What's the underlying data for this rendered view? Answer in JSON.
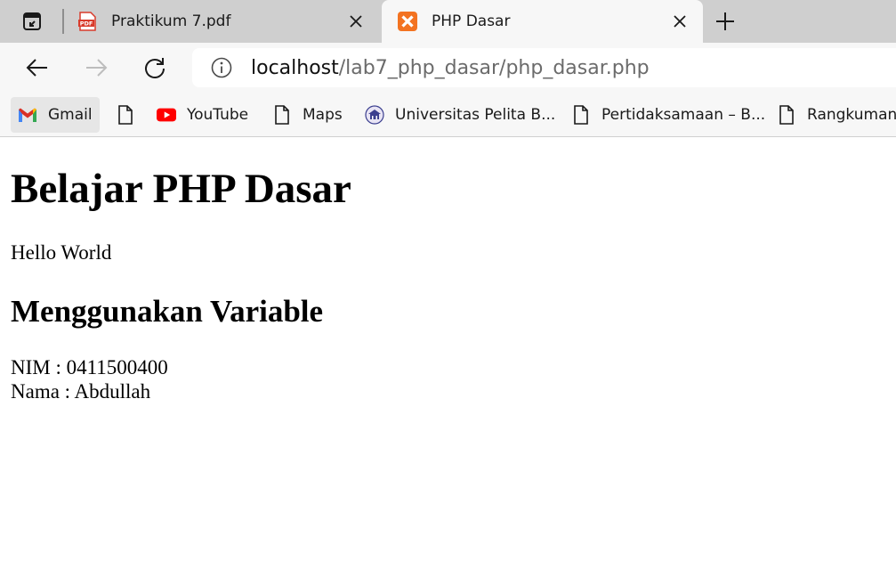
{
  "tabs": [
    {
      "title": "Praktikum 7.pdf",
      "icon": "pdf-icon",
      "active": false
    },
    {
      "title": "PHP Dasar",
      "icon": "xampp-icon",
      "active": true
    }
  ],
  "address": {
    "host": "localhost",
    "path": "/lab7_php_dasar/php_dasar.php"
  },
  "bookmarks": [
    {
      "label": "Gmail",
      "icon": "gmail-icon"
    },
    {
      "label": "",
      "icon": "page-icon"
    },
    {
      "label": "YouTube",
      "icon": "youtube-icon"
    },
    {
      "label": "Maps",
      "icon": "page-icon"
    },
    {
      "label": "Universitas Pelita B...",
      "icon": "university-icon"
    },
    {
      "label": "Pertidaksamaan – B...",
      "icon": "page-icon"
    },
    {
      "label": "Rangkuman,",
      "icon": "page-icon"
    }
  ],
  "page": {
    "heading": "Belajar PHP Dasar",
    "hello": "Hello World",
    "subheading": "Menggunakan Variable",
    "nim_line": "NIM : 0411500400",
    "nama_line": "Nama : Abdullah"
  },
  "colors": {
    "tabstrip_bg": "#cfcfcf",
    "toolbar_bg": "#f7f7f7",
    "pdf_red": "#d83b2b",
    "xampp_orange": "#f37321",
    "youtube_red": "#ff0000"
  }
}
